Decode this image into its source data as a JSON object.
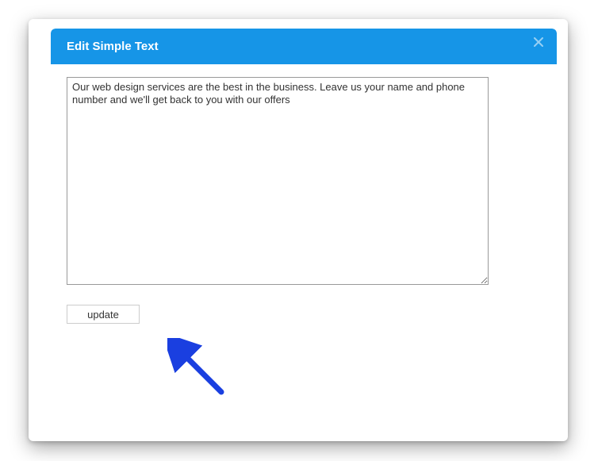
{
  "modal": {
    "title": "Edit Simple Text",
    "textarea_value": "Our web design services are the best in the business. Leave us your name and phone number and we'll get back to you with our offers",
    "update_label": "update"
  },
  "colors": {
    "header_bg": "#1695e7",
    "arrow": "#1a3fe0"
  }
}
